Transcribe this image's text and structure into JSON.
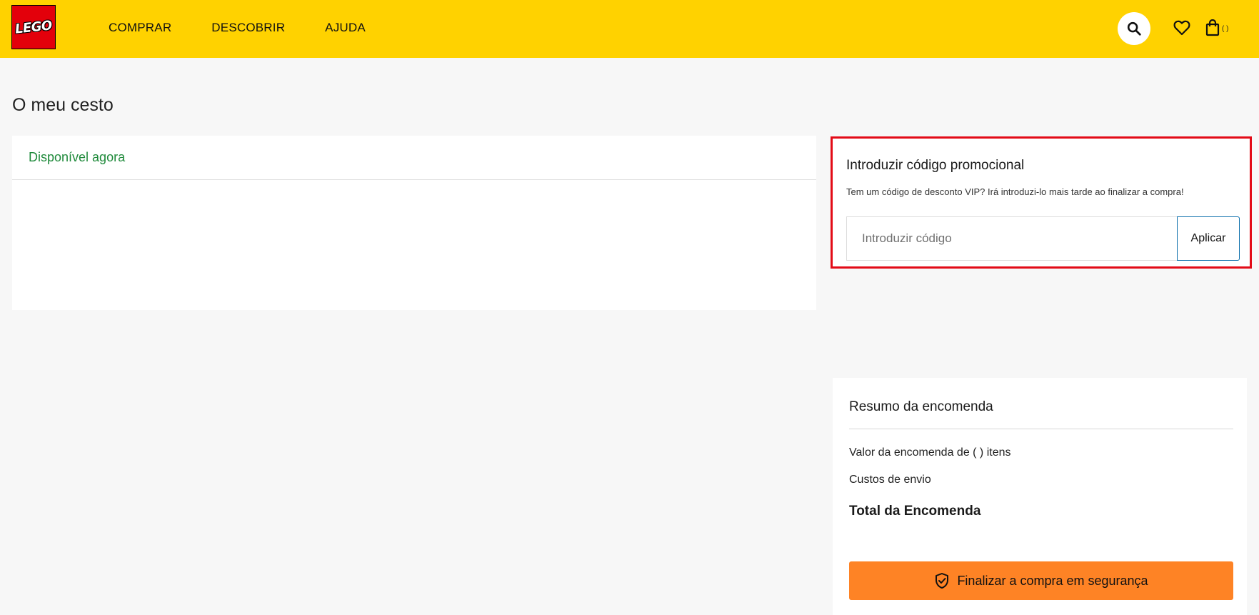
{
  "header": {
    "logo_text": "LEGO",
    "nav": [
      "COMPRAR",
      "DESCOBRIR",
      "AJUDA"
    ],
    "bag_count": "( )",
    "icons": {
      "search": "search-icon",
      "wishlist": "heart-icon",
      "bag": "shopping-bag-icon"
    },
    "background_color": "#ffd200"
  },
  "page": {
    "title": "O meu cesto"
  },
  "items_panel": {
    "available_label": "Disponível agora"
  },
  "promo": {
    "title": "Introduzir código promocional",
    "note": "Tem um código de desconto VIP? Irá introduzi-lo mais tarde ao finalizar a compra!",
    "input_value": "",
    "input_placeholder": "Introduzir código",
    "apply_label": "Aplicar",
    "highlight_color": "#e30b17"
  },
  "summary": {
    "title": "Resumo da encomenda",
    "order_value_label": "Valor da encomenda de ( ) itens",
    "shipping_label": "Custos de envio",
    "total_label": "Total da Encomenda",
    "checkout_label": "Finalizar a compra em segurança",
    "checkout_icon": "shield-check-icon",
    "checkout_color": "#fe8325"
  }
}
